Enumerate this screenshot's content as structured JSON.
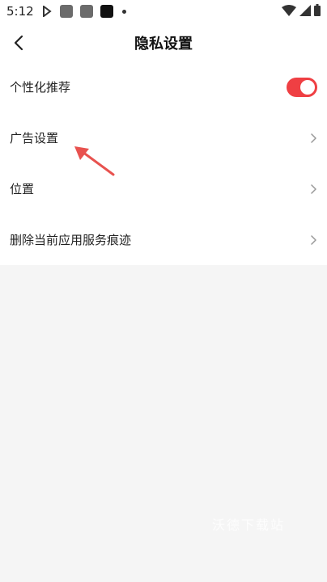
{
  "status_bar": {
    "time": "5:12",
    "icons": [
      "play-store-icon",
      "app-icon",
      "app-icon",
      "app-icon",
      "more-dot-icon"
    ],
    "right_icons": [
      "wifi-icon",
      "signal-icon",
      "battery-icon"
    ],
    "colors": {
      "square1": "#6b6b6b",
      "square2": "#6b6b6b",
      "square3": "#111111"
    }
  },
  "header": {
    "title": "隐私设置",
    "back_icon": "back-chevron-icon"
  },
  "settings": {
    "items": [
      {
        "label": "个性化推荐",
        "control": "toggle",
        "toggle_on": true
      },
      {
        "label": "广告设置",
        "control": "chevron"
      },
      {
        "label": "位置",
        "control": "chevron"
      },
      {
        "label": "删除当前应用服务痕迹",
        "control": "chevron"
      }
    ]
  },
  "accent_color": "#ef3f43",
  "watermark": {
    "text": "沃德下载站"
  }
}
